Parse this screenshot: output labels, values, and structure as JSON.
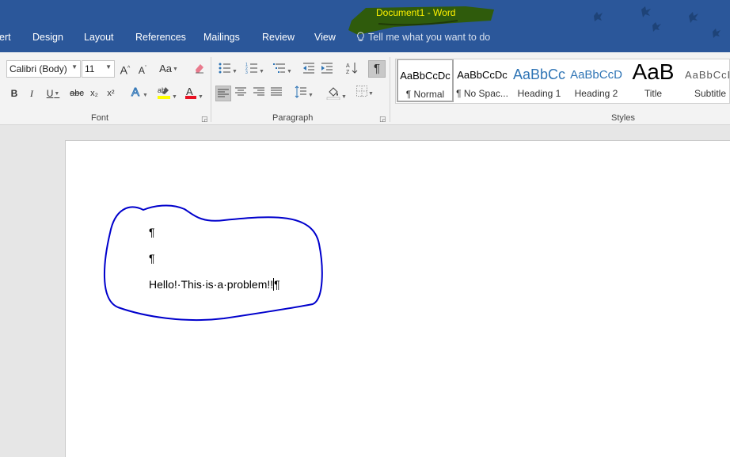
{
  "window": {
    "title": "Document1 - Word",
    "highlight_color": "#2f5b0c",
    "titlebar_color": "#2b579a"
  },
  "tabs": [
    "ert",
    "Design",
    "Layout",
    "References",
    "Mailings",
    "Review",
    "View"
  ],
  "tell_me": "Tell me what you want to do",
  "font": {
    "name": "Calibri (Body)",
    "size": "11",
    "group_label": "Font",
    "bold": "B",
    "italic": "I",
    "underline": "U",
    "strike": "abc",
    "subscript": "x₂",
    "superscript": "x²",
    "grow": "A",
    "shrink": "A",
    "change_case": "Aa",
    "font_color": "#e81123",
    "highlight_color": "#ffff00"
  },
  "paragraph": {
    "group_label": "Paragraph",
    "show_marks": "¶"
  },
  "styles": {
    "group_label": "Styles",
    "items": [
      {
        "sample": "AaBbCcDc",
        "name": "¶ Normal",
        "color": "#000000"
      },
      {
        "sample": "AaBbCcDc",
        "name": "¶ No Spac...",
        "color": "#000000"
      },
      {
        "sample": "AaBbCc",
        "name": "Heading 1",
        "color": "#2e74b5"
      },
      {
        "sample": "AaBbCcD",
        "name": "Heading 2",
        "color": "#2e74b5"
      },
      {
        "sample": "AaB",
        "name": "Title",
        "color": "#000000"
      },
      {
        "sample": "AaBbCcD",
        "name": "Subtitle",
        "color": "#595959"
      }
    ]
  },
  "document": {
    "paragraphs": [
      "¶",
      "¶",
      "Hello!·This·is·a·problem!!"
    ],
    "end_mark": "¶",
    "annotation_color": "#0000cc"
  }
}
